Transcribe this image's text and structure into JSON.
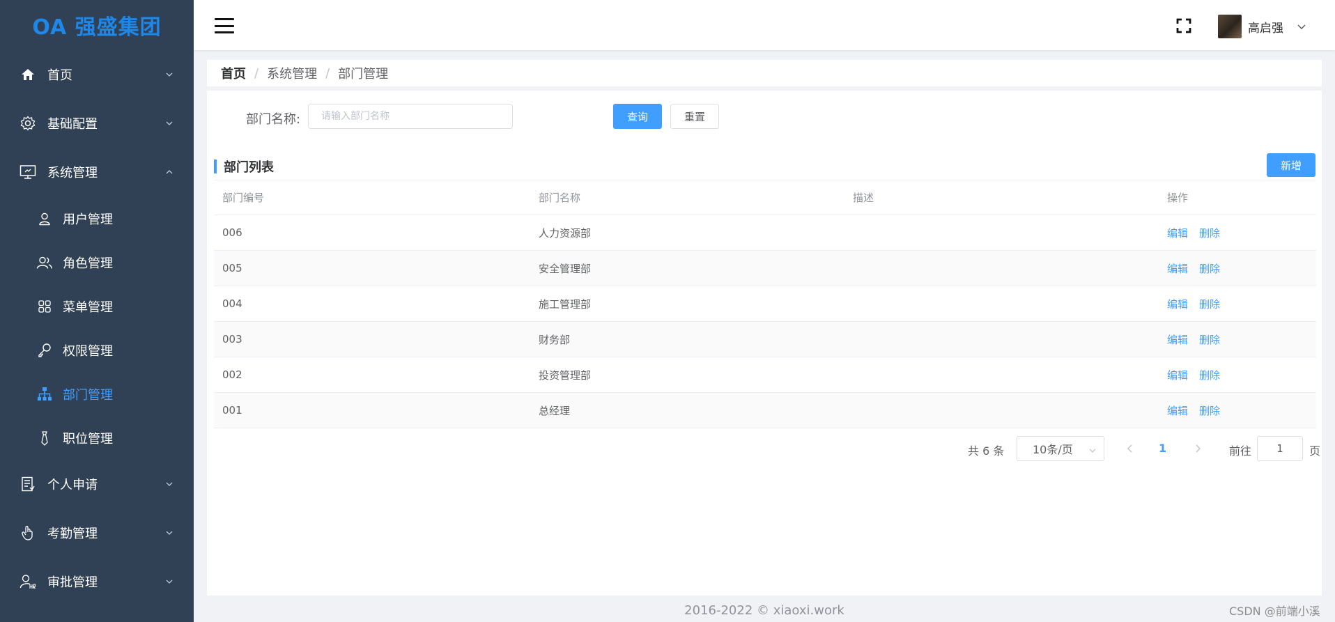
{
  "sidebar": {
    "logo": "OA 强盛集团",
    "menu": [
      {
        "label": "首页",
        "icon": "home-icon"
      },
      {
        "label": "基础配置",
        "icon": "gear-icon"
      },
      {
        "label": "系统管理",
        "icon": "monitor-icon"
      }
    ],
    "submenu": [
      {
        "label": "用户管理",
        "icon": "user-icon"
      },
      {
        "label": "角色管理",
        "icon": "users-icon"
      },
      {
        "label": "菜单管理",
        "icon": "grid-icon"
      },
      {
        "label": "权限管理",
        "icon": "key-icon"
      },
      {
        "label": "部门管理",
        "icon": "org-tree-icon",
        "active": true
      },
      {
        "label": "职位管理",
        "icon": "tie-icon"
      }
    ],
    "menu_after": [
      {
        "label": "个人申请",
        "icon": "document-icon"
      },
      {
        "label": "考勤管理",
        "icon": "hand-icon"
      },
      {
        "label": "审批管理",
        "icon": "approver-icon"
      }
    ],
    "active_color": "#409eff",
    "background": "#304156"
  },
  "header": {
    "username": "高启强"
  },
  "breadcrumb": {
    "home": "首页",
    "items": [
      "系统管理",
      "部门管理"
    ],
    "separator": "/"
  },
  "filter": {
    "label": "部门名称:",
    "placeholder": "请输入部门名称",
    "query_label": "查询",
    "reset_label": "重置"
  },
  "section": {
    "title": "部门列表",
    "add_label": "新增"
  },
  "table": {
    "columns": [
      "部门编号",
      "部门名称",
      "描述",
      "操作"
    ],
    "rows": [
      {
        "id": "006",
        "name": "人力资源部",
        "desc": ""
      },
      {
        "id": "005",
        "name": "安全管理部",
        "desc": ""
      },
      {
        "id": "004",
        "name": "施工管理部",
        "desc": ""
      },
      {
        "id": "003",
        "name": "财务部",
        "desc": ""
      },
      {
        "id": "002",
        "name": "投资管理部",
        "desc": ""
      },
      {
        "id": "001",
        "name": "总经理",
        "desc": ""
      }
    ],
    "edit_label": "编辑",
    "delete_label": "删除"
  },
  "pagination": {
    "total_text": "共 6 条",
    "page_size": "10条/页",
    "current_page": "1",
    "goto_label": "前往",
    "goto_value": "1",
    "page_suffix": "页"
  },
  "footer": {
    "copyright": "2016-2022 © xiaoxi.work",
    "watermark": "CSDN @前端小溪"
  },
  "colors": {
    "primary": "#409eff",
    "sidebar_bg": "#304156",
    "logo": "#1f87e8"
  }
}
